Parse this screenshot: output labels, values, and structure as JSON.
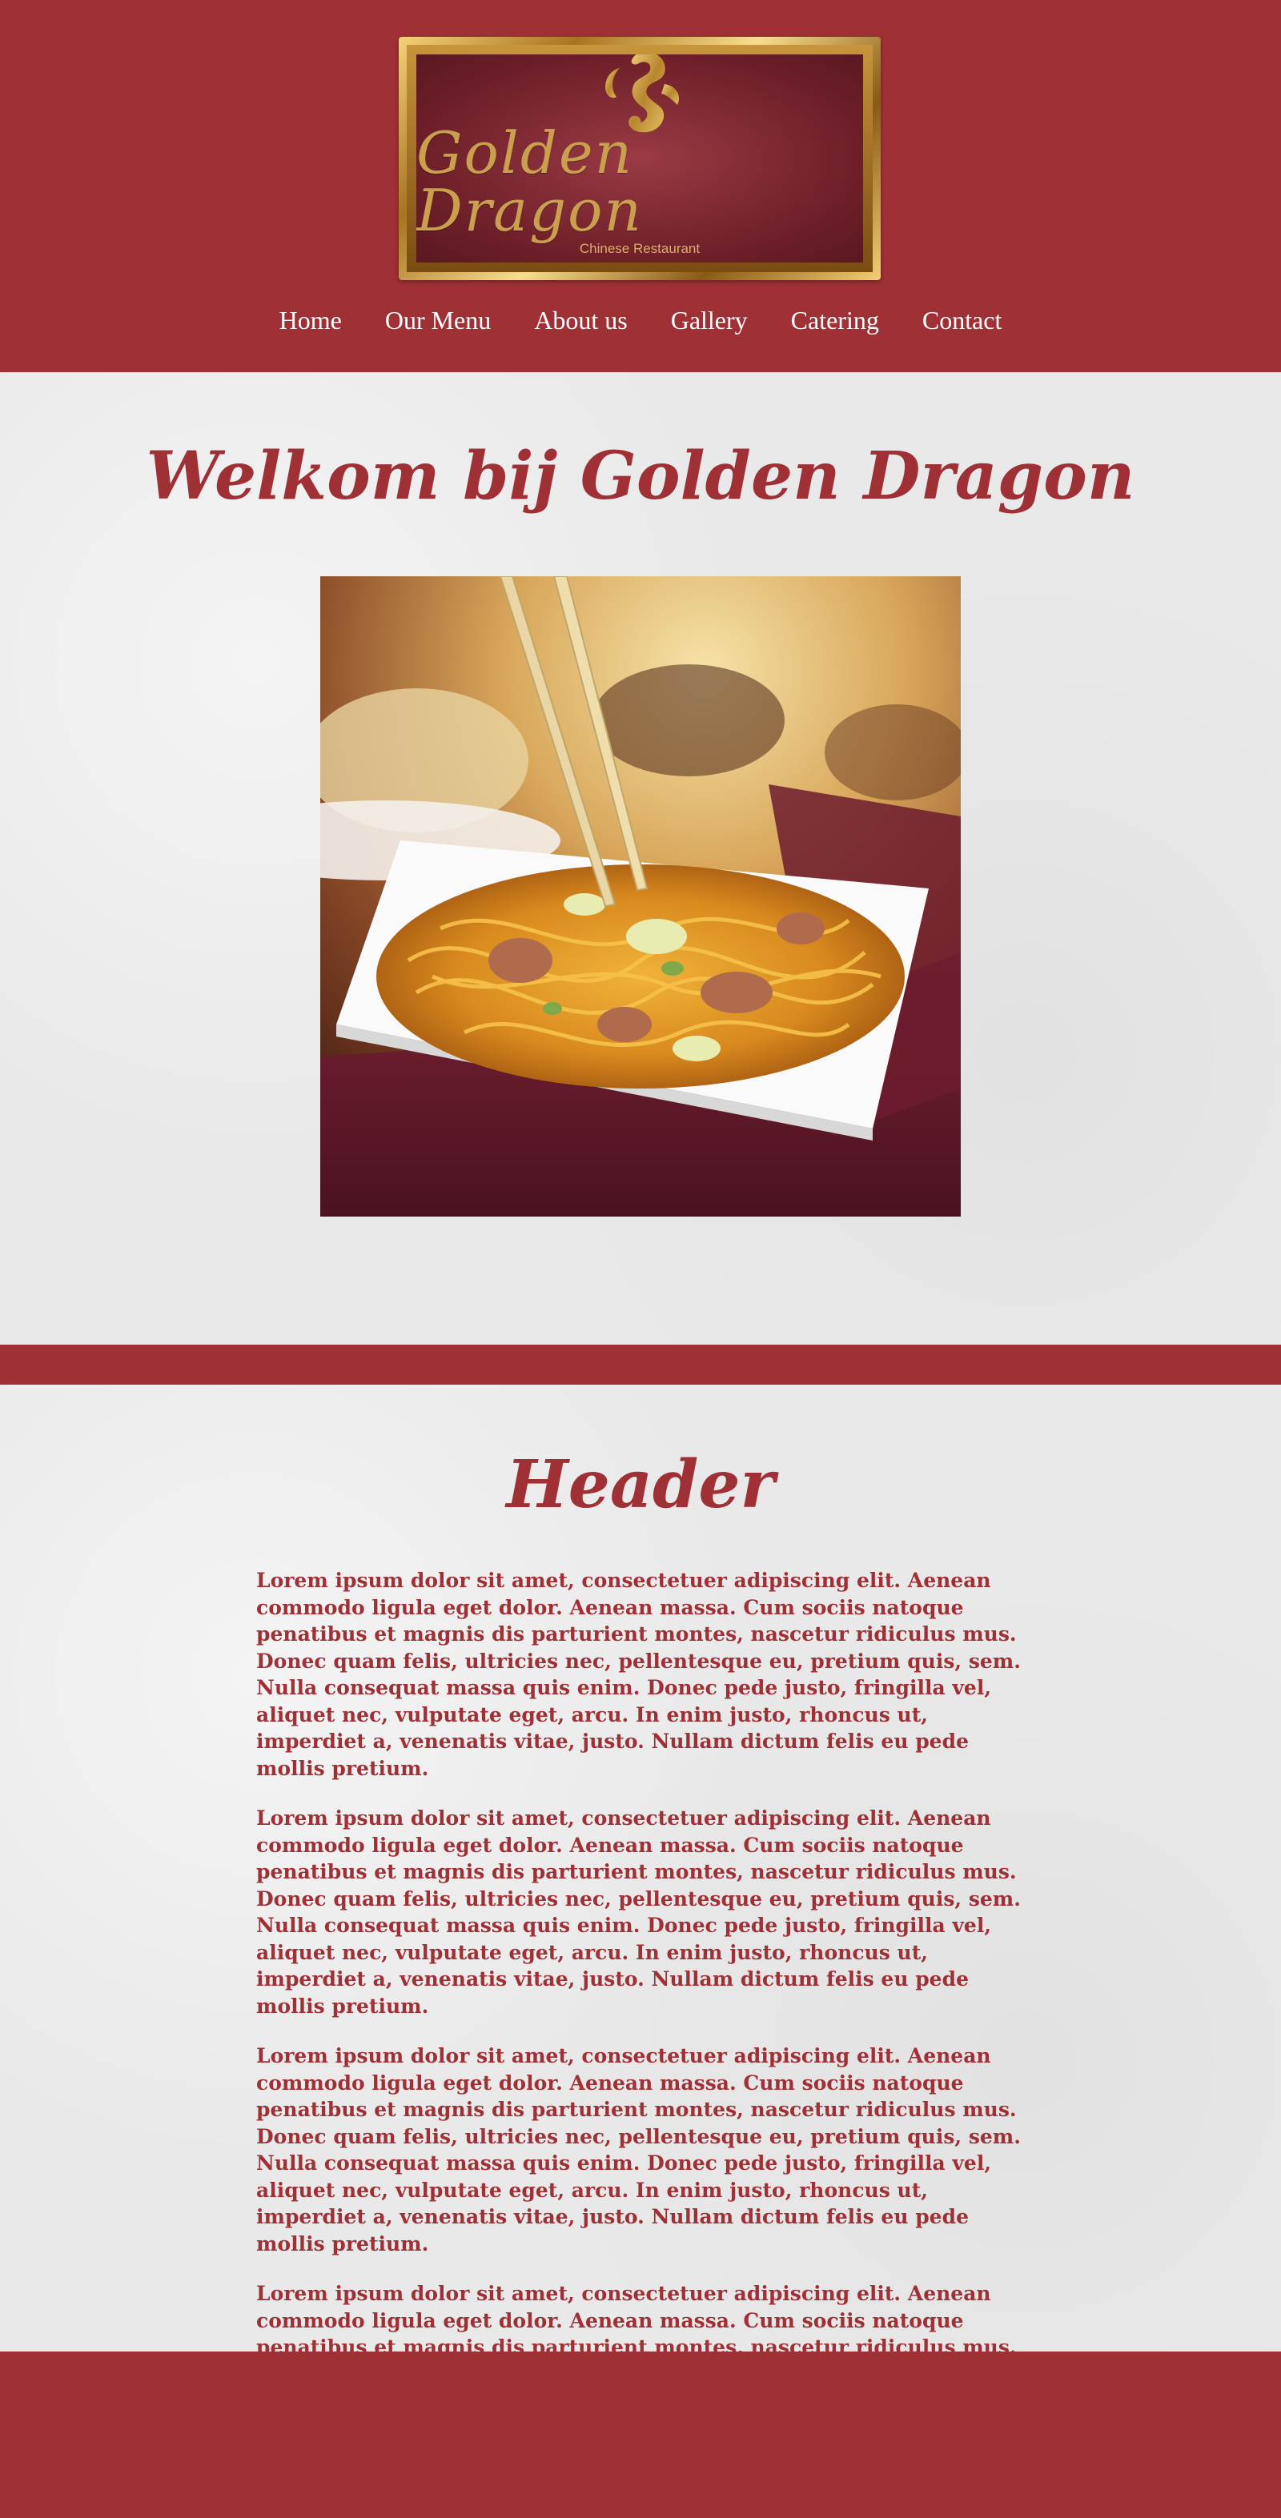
{
  "brand": {
    "logo_name": "Golden Dragon",
    "logo_tagline": "Chinese Restaurant"
  },
  "nav": {
    "items": [
      {
        "label": "Home"
      },
      {
        "label": "Our Menu"
      },
      {
        "label": "About us"
      },
      {
        "label": "Gallery"
      },
      {
        "label": "Catering"
      },
      {
        "label": "Contact"
      }
    ]
  },
  "hero": {
    "title": "Welkom bij Golden Dragon"
  },
  "content": {
    "title": "Header",
    "paragraphs": [
      "Lorem ipsum dolor sit amet, consectetuer adipiscing elit. Aenean commodo ligula eget dolor. Aenean massa. Cum sociis natoque penatibus et magnis dis parturient montes, nascetur ridiculus mus. Donec quam felis, ultricies nec, pellentesque eu, pretium quis, sem. Nulla consequat massa quis enim. Donec pede justo, fringilla vel, aliquet nec, vulputate eget, arcu. In enim justo, rhoncus ut, imperdiet a, venenatis vitae, justo. Nullam dictum felis eu pede mollis pretium.",
      "Lorem ipsum dolor sit amet, consectetuer adipiscing elit. Aenean commodo ligula eget dolor. Aenean massa. Cum sociis natoque penatibus et magnis dis parturient montes, nascetur ridiculus mus. Donec quam felis, ultricies nec, pellentesque eu, pretium quis, sem. Nulla consequat massa quis enim. Donec pede justo, fringilla vel, aliquet nec, vulputate eget, arcu. In enim justo, rhoncus ut, imperdiet a, venenatis vitae, justo. Nullam dictum felis eu pede mollis pretium.",
      "Lorem ipsum dolor sit amet, consectetuer adipiscing elit. Aenean commodo ligula eget dolor. Aenean massa. Cum sociis natoque penatibus et magnis dis parturient montes, nascetur ridiculus mus. Donec quam felis, ultricies nec, pellentesque eu, pretium quis, sem. Nulla consequat massa quis enim. Donec pede justo, fringilla vel, aliquet nec, vulputate eget, arcu. In enim justo, rhoncus ut, imperdiet a, venenatis vitae, justo. Nullam dictum felis eu pede mollis pretium.",
      "Lorem ipsum dolor sit amet, consectetuer adipiscing elit. Aenean commodo ligula eget dolor. Aenean massa. Cum sociis natoque penatibus et magnis dis parturient montes, nascetur ridiculus mus. Donec quam felis, ultricies nec, pellentesque eu, pretium quis, sem. Nulla consequat massa quis enim. Donec pede justo, fringilla vel, aliquet nec, vulputate eget, arcu. In enim justo, rhoncus ut, imperdiet a, venenatis vitae, justo. Nullam dictum felis eu pede mollis pretium."
    ]
  },
  "colors": {
    "brand_red": "#9f3136",
    "background_light": "#e9e9e9",
    "logo_gold": "#caa04e",
    "nav_text": "#ffffff"
  },
  "icons": {
    "logo_emblem": "dragon-icon"
  }
}
